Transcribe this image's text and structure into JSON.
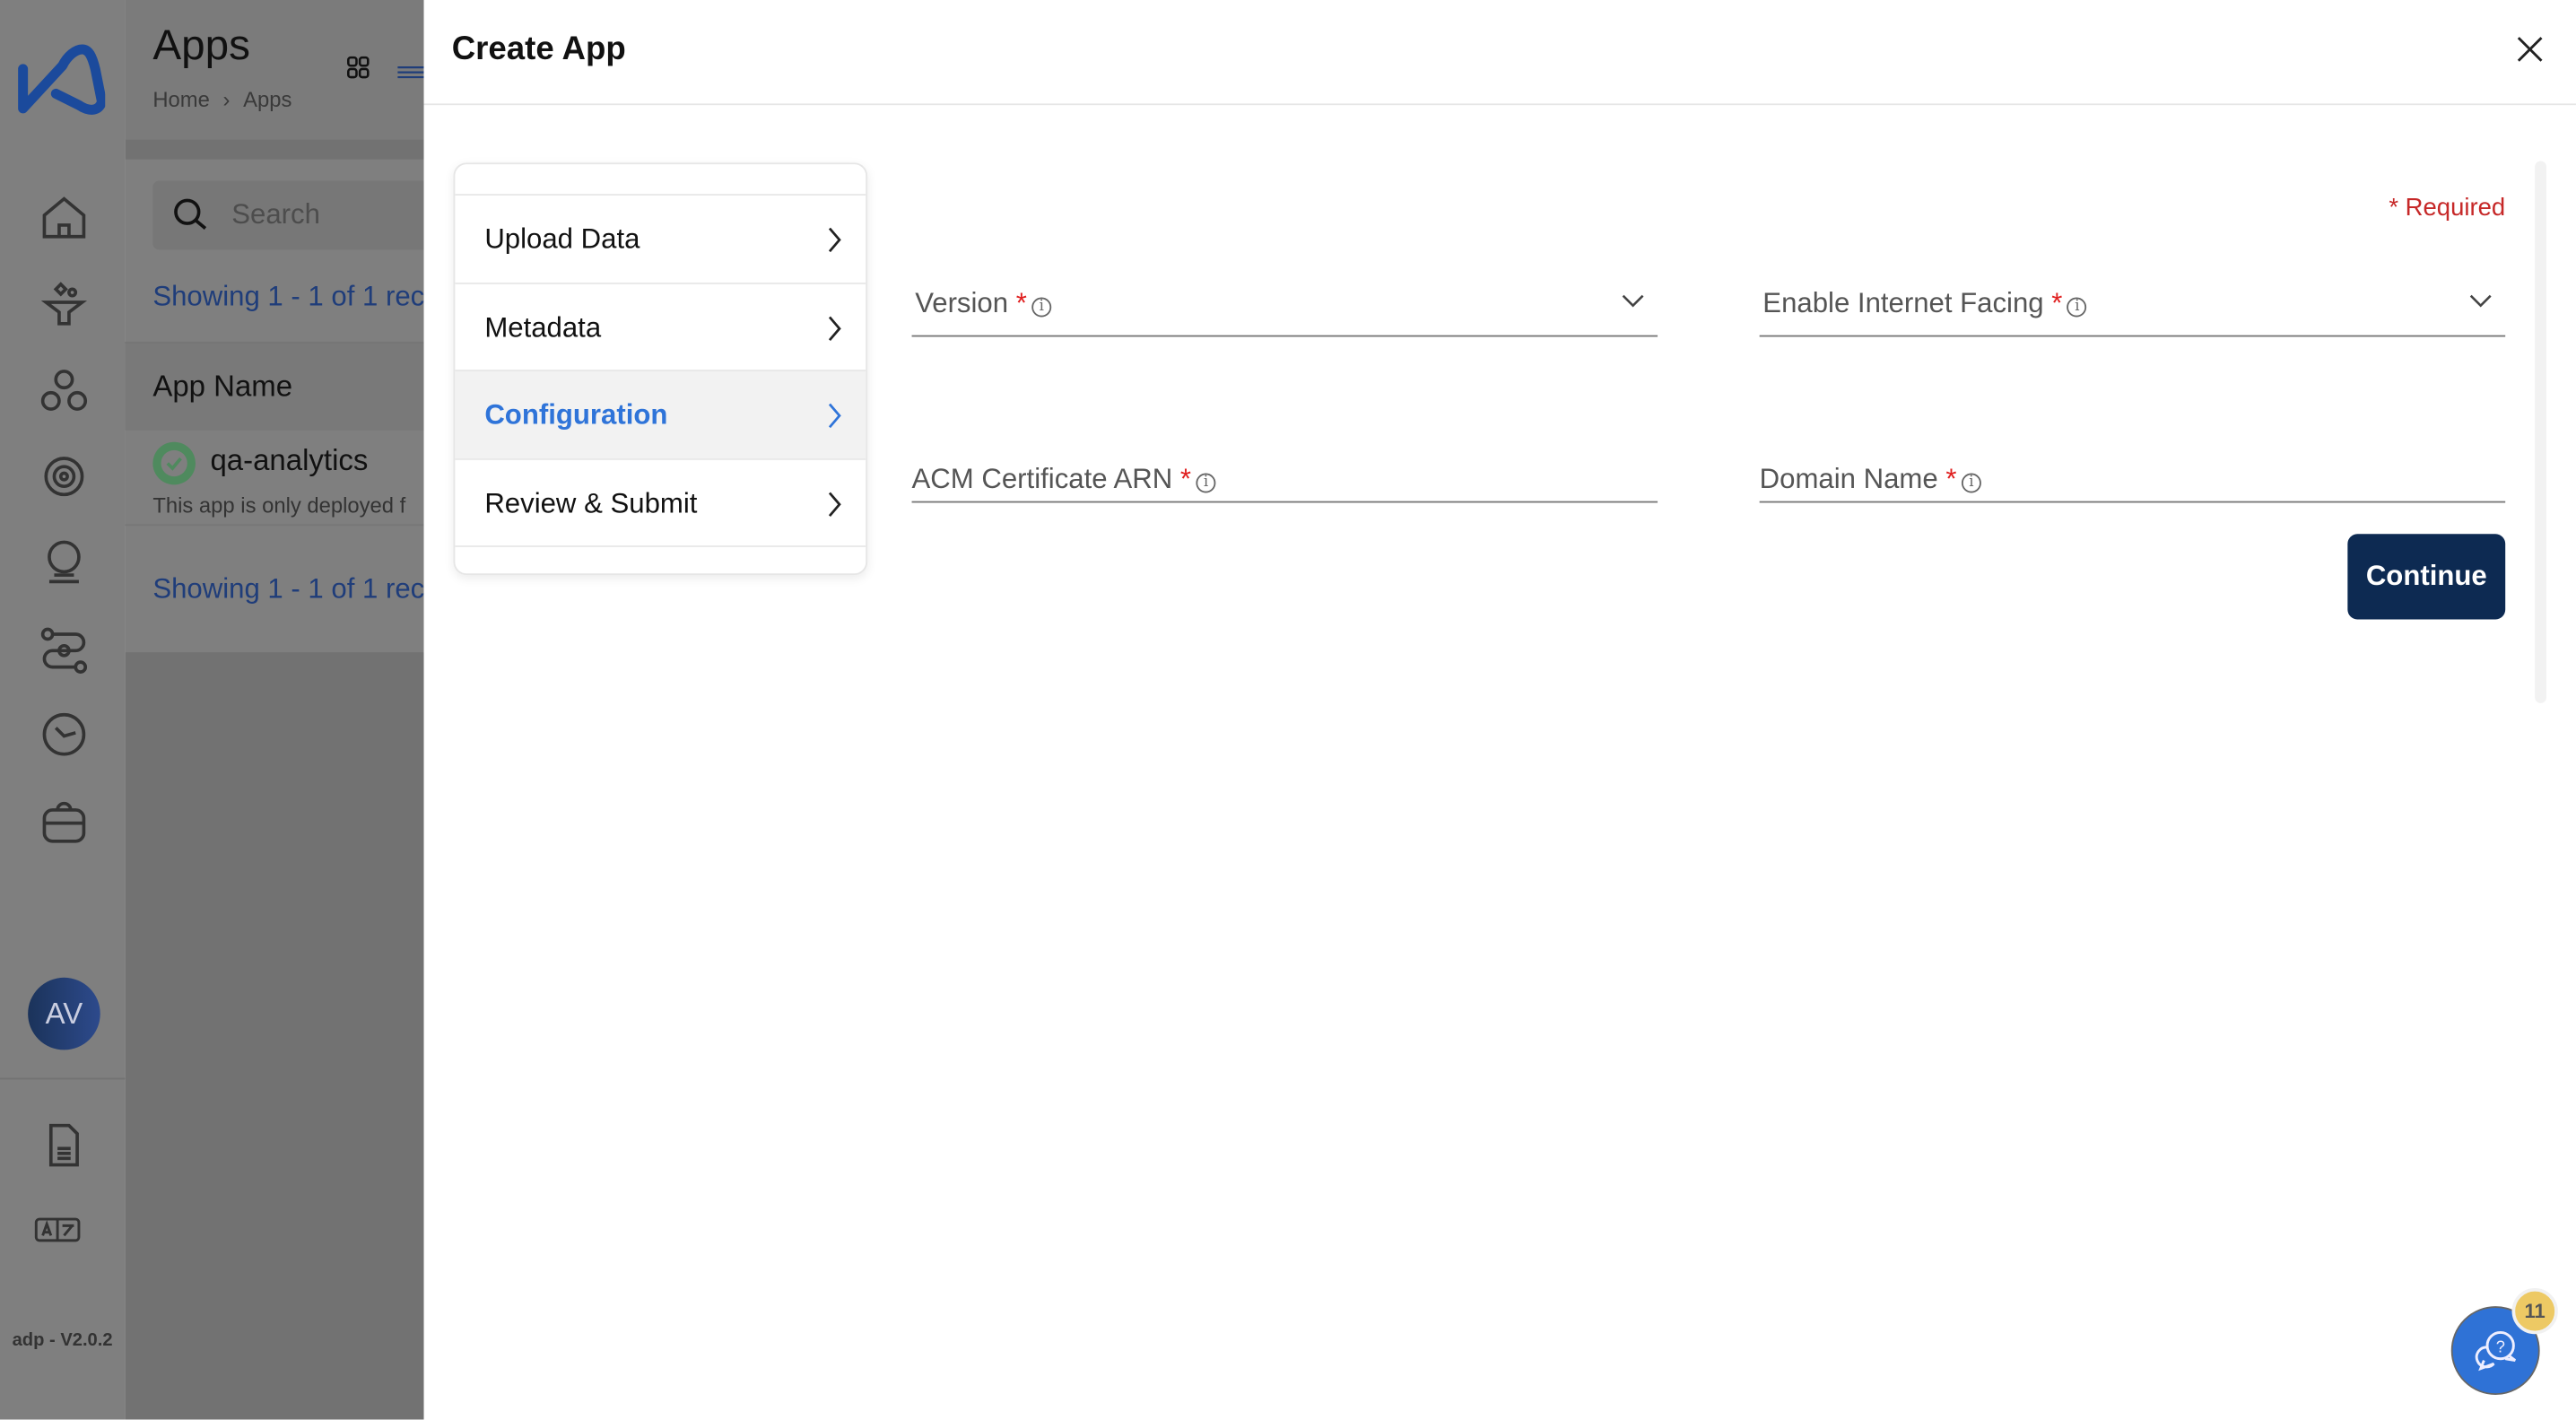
{
  "sidebar": {
    "icons": [
      "logo",
      "home-icon",
      "funnel-icon",
      "hierarchy-icon",
      "settings-sync-icon",
      "crystal-ball-icon",
      "route-icon",
      "clock-icon",
      "briefcase-icon",
      "document-icon",
      "translate-icon"
    ],
    "avatar_initials": "AV",
    "version": "adp - V2.0.2",
    "brand_color": "#1b4a9c"
  },
  "background_page": {
    "title": "Apps",
    "breadcrumb": [
      "Home",
      "Apps"
    ],
    "search_placeholder": "Search",
    "showing_text": "Showing 1 - 1 of 1 rec",
    "column_header": "App Name",
    "rows": [
      {
        "name": "qa-analytics",
        "status": "success",
        "description": "This app is only deployed f"
      }
    ]
  },
  "drawer": {
    "title": "Create App",
    "steps": [
      {
        "label": "Upload Data",
        "active": false
      },
      {
        "label": "Metadata",
        "active": false
      },
      {
        "label": "Configuration",
        "active": true
      },
      {
        "label": "Review & Submit",
        "active": false
      }
    ],
    "required_note": "* Required",
    "fields": {
      "version": {
        "label": "Version",
        "required": "*",
        "type": "select"
      },
      "internet_facing": {
        "label": "Enable Internet Facing",
        "required": "*",
        "type": "select"
      },
      "acm_arn": {
        "label": "ACM Certificate ARN",
        "required": "*",
        "type": "text"
      },
      "domain": {
        "label": "Domain Name",
        "required": "*",
        "type": "text"
      }
    },
    "continue_label": "Continue",
    "help_badge_count": "11"
  },
  "colors": {
    "accent": "#2f74d9",
    "primary_button": "#0d2a52",
    "required": "#c62828",
    "badge": "#edc964"
  }
}
